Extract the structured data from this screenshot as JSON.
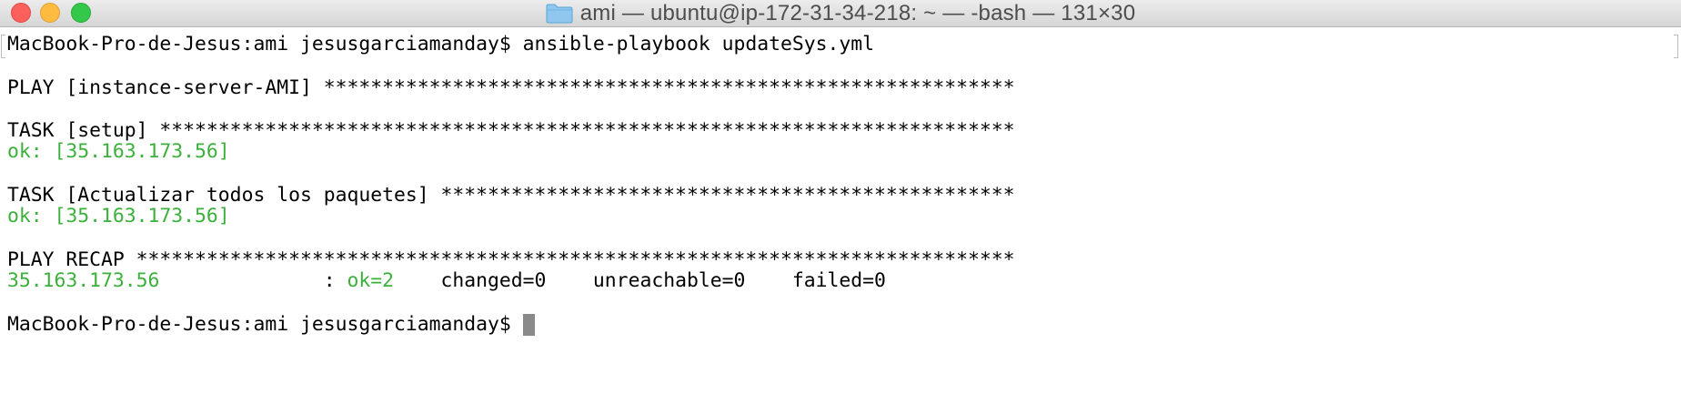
{
  "window": {
    "title": "ami — ubuntu@ip-172-31-34-218: ~ — -bash — 131×30",
    "folder_icon": "folder-icon",
    "colors": {
      "close": "#fc605c",
      "minimize": "#fdbc40",
      "maximize": "#34c84a"
    }
  },
  "terminal": {
    "colors": {
      "text": "#000000",
      "ok": "#3bb13b",
      "background": "#ffffff"
    },
    "command_prompt": "MacBook-Pro-de-Jesus:ami jesusgarciamanday$ ",
    "command": "ansible-playbook updateSys.yml",
    "play_header": "PLAY [instance-server-AMI] ***********************************************************",
    "task1_header": "TASK [setup] *************************************************************************",
    "task1_result": "ok: [35.163.173.56]",
    "task2_header": "TASK [Actualizar todos los paquetes] *************************************************",
    "task2_result": "ok: [35.163.173.56]",
    "recap_header": "PLAY RECAP ***************************************************************************",
    "recap_host": "35.163.173.56",
    "recap_sep": "              : ",
    "recap_ok": "ok=2",
    "recap_rest": "    changed=0    unreachable=0    failed=0",
    "final_prompt": "MacBook-Pro-de-Jesus:ami jesusgarciamanday$ "
  }
}
